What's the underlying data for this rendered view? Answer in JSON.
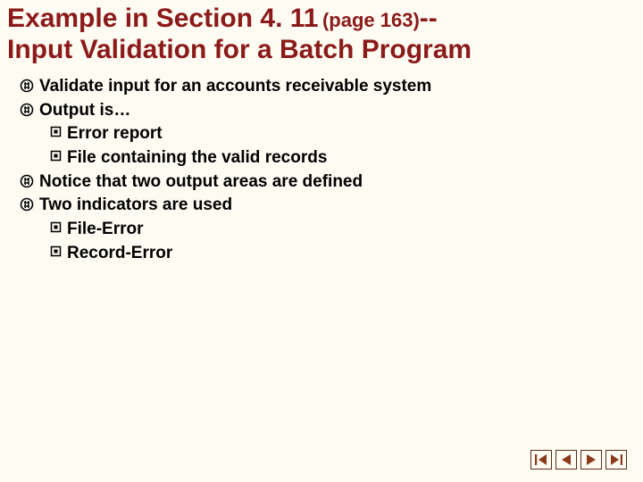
{
  "title": {
    "part1": "Example in Section 4. 11",
    "page": "(page 163)",
    "dashes": "--",
    "part2": "Input Validation for a Batch Program"
  },
  "bullets": {
    "b0": "Validate input for an accounts receivable system",
    "b1": "Output is…",
    "b1s0": "Error report",
    "b1s1": "File containing the valid records",
    "b2": "Notice that two output areas are defined",
    "b3": "Two indicators are used",
    "b3s0": "File-Error",
    "b3s1": "Record-Error"
  }
}
